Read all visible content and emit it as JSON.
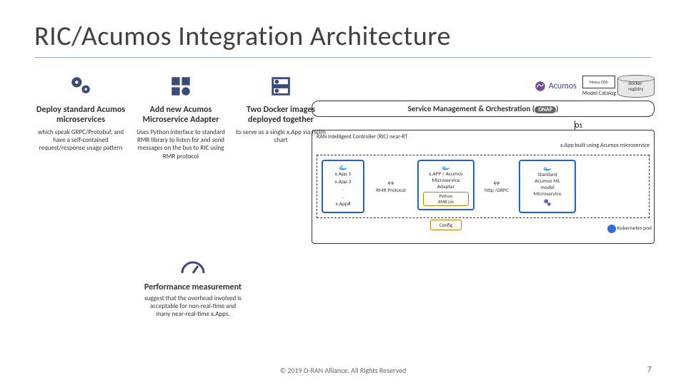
{
  "title": "RIC/Acumos Integration Architecture",
  "columns": {
    "deploy": {
      "heading": "Deploy standard Acumos microservices",
      "body": "which speak GRPC/Protobuf, and have a self-contained request/response usage pattern"
    },
    "adapter": {
      "heading": "Add new Acumos Microservice Adapter",
      "body": "Uses Python interface to standard RMR library to listen for and send messages on the bus to RIC using RMR protocol"
    },
    "docker": {
      "heading": "Two Docker images deployed together",
      "body": "to serve as a single x.App via Helm chart"
    }
  },
  "perf": {
    "heading": "Performance measurement",
    "body": "suggest that the overhead involved is acceptable for non-real-time and many near-real-time x.Apps."
  },
  "top": {
    "acumos": "Acumos",
    "nexus": "Nexus OSS",
    "mc": "Model Catalog",
    "docker_registry": "docker\nregistry"
  },
  "smo": {
    "label": "Service Management & Orchestration (",
    "onap": "ONAP",
    "close": ")"
  },
  "ric": {
    "title": "RAN Intelligent Controller (RIC) near-RT",
    "o1": "O1",
    "xapp_label": "x.App built using Acumos microservice"
  },
  "pod": {
    "xapps": [
      "x.App 1",
      "x.App 2",
      ".",
      ".",
      "x.App#"
    ],
    "rmr": "RMR Protocol",
    "adapter": "x.APP / Acumos\nMicroservice\nAdapter",
    "python": "Python\nRMR Lib",
    "http": "http /GRPC",
    "ml": "Standard\nAcumos ML\nmodel\nMicroservice",
    "config": "Config",
    "k8s": "Kubernetes pod"
  },
  "footer": "© 2019 O-RAN Alliance. All Rights Reserved",
  "page": "7"
}
